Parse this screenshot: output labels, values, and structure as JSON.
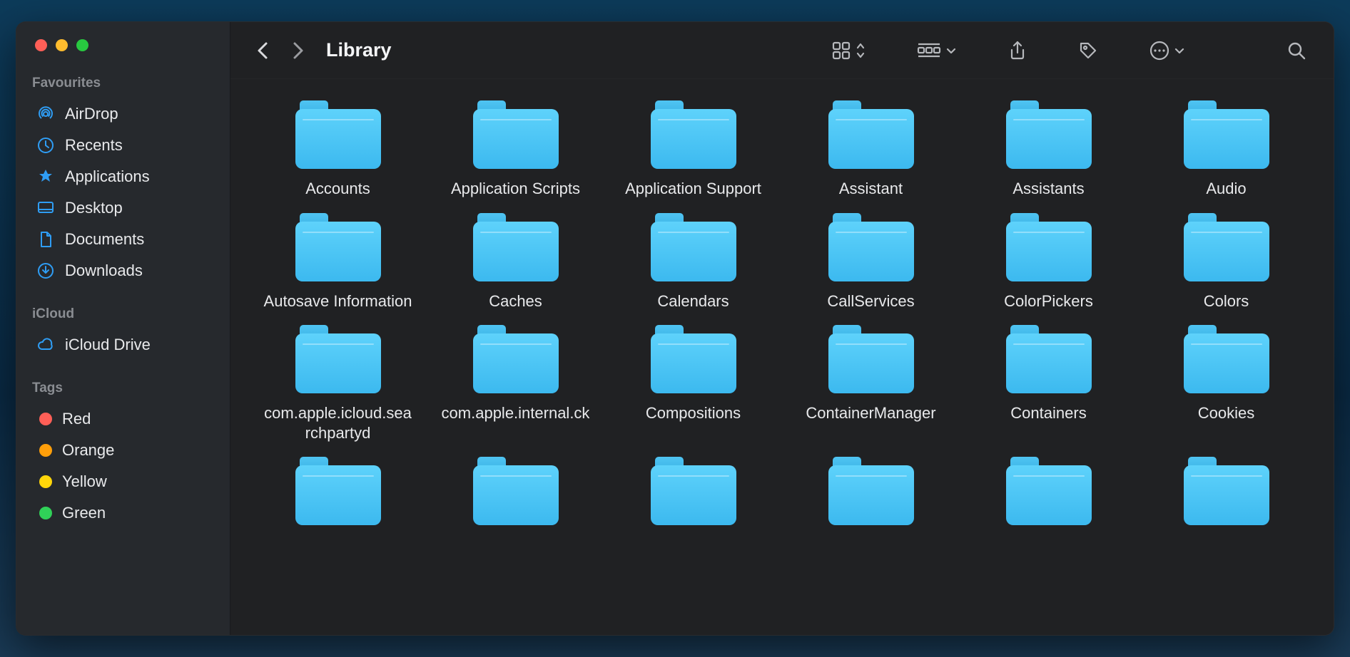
{
  "window": {
    "title": "Library"
  },
  "sidebar": {
    "sections": [
      {
        "heading": "Favourites",
        "items": [
          {
            "icon": "airdrop",
            "label": "AirDrop"
          },
          {
            "icon": "recents",
            "label": "Recents"
          },
          {
            "icon": "applications",
            "label": "Applications"
          },
          {
            "icon": "desktop",
            "label": "Desktop"
          },
          {
            "icon": "documents",
            "label": "Documents"
          },
          {
            "icon": "downloads",
            "label": "Downloads"
          }
        ]
      },
      {
        "heading": "iCloud",
        "items": [
          {
            "icon": "cloud",
            "label": "iCloud Drive"
          }
        ]
      },
      {
        "heading": "Tags",
        "items": [
          {
            "icon": "tag",
            "color": "#ff5f57",
            "label": "Red"
          },
          {
            "icon": "tag",
            "color": "#ff9f0a",
            "label": "Orange"
          },
          {
            "icon": "tag",
            "color": "#ffd60a",
            "label": "Yellow"
          },
          {
            "icon": "tag",
            "color": "#30d158",
            "label": "Green"
          }
        ]
      }
    ]
  },
  "folders": [
    "Accounts",
    "Application Scripts",
    "Application Support",
    "Assistant",
    "Assistants",
    "Audio",
    "Autosave Information",
    "Caches",
    "Calendars",
    "CallServices",
    "ColorPickers",
    "Colors",
    "com.apple.icloud.searchpartyd",
    "com.apple.internal.ck",
    "Compositions",
    "ContainerManager",
    "Containers",
    "Cookies",
    "",
    "",
    "",
    "",
    "",
    ""
  ]
}
